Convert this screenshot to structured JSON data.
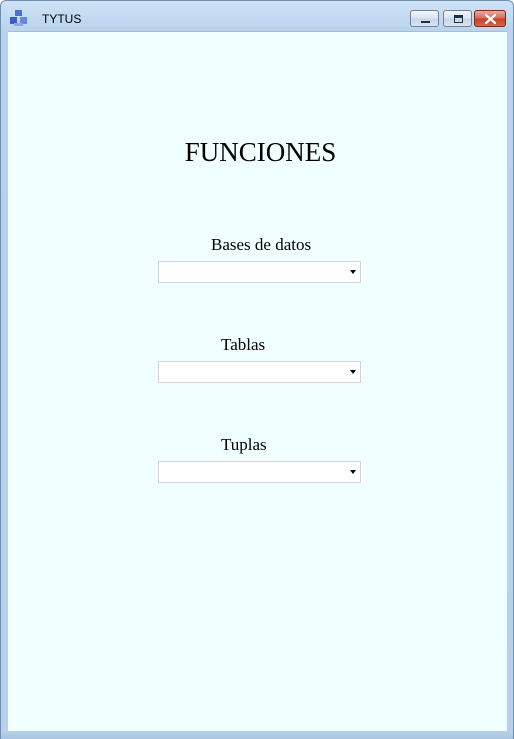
{
  "window": {
    "title": "TYTUS",
    "icon": "app-logo-icon",
    "controls": {
      "minimize_icon": "minimize-icon",
      "maximize_icon": "maximize-icon",
      "close_icon": "close-icon"
    }
  },
  "main": {
    "heading": "FUNCIONES",
    "background": "#f0ffff",
    "fields": {
      "databases": {
        "label": "Bases de datos",
        "value": ""
      },
      "tables": {
        "label": "Tablas",
        "value": ""
      },
      "tuples": {
        "label": "Tuplas",
        "value": ""
      }
    }
  }
}
